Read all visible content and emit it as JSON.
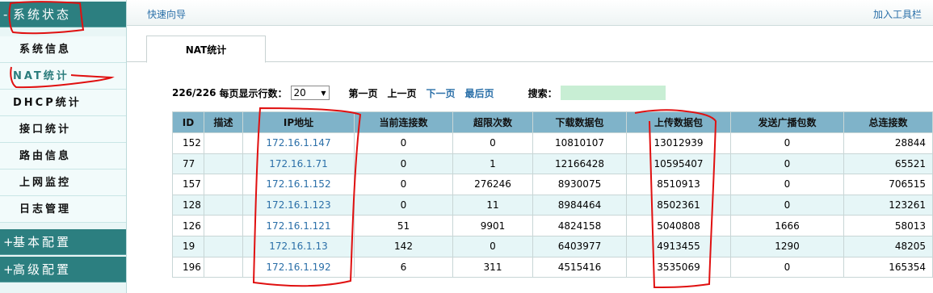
{
  "sidebar": {
    "sections": [
      {
        "sign": "-",
        "label": "系统状态"
      },
      {
        "sign": "+",
        "label": "基本配置"
      },
      {
        "sign": "+",
        "label": "高级配置"
      }
    ],
    "items": [
      "系统信息",
      "NAT统计",
      "DHCP统计",
      "接口统计",
      "路由信息",
      "上网监控",
      "日志管理"
    ]
  },
  "topbar": {
    "quick_guide": "快速向导",
    "add_toolbar": "加入工具栏"
  },
  "tab": {
    "label": "NAT统计"
  },
  "pager": {
    "count": "226/226",
    "rows_label": "每页显示行数：",
    "rows_value": "20",
    "first": "第一页",
    "prev": "上一页",
    "next": "下一页",
    "last": "最后页",
    "search_label": "搜索："
  },
  "table": {
    "headers": [
      "ID",
      "描述",
      "IP地址",
      "当前连接数",
      "超限次数",
      "下载数据包",
      "上传数据包",
      "发送广播包数",
      "总连接数"
    ],
    "rows": [
      [
        "152",
        "",
        "172.16.1.147",
        "0",
        "0",
        "10810107",
        "13012939",
        "0",
        "28844"
      ],
      [
        "77",
        "",
        "172.16.1.71",
        "0",
        "1",
        "12166428",
        "10595407",
        "0",
        "65521"
      ],
      [
        "157",
        "",
        "172.16.1.152",
        "0",
        "276246",
        "8930075",
        "8510913",
        "0",
        "706515"
      ],
      [
        "128",
        "",
        "172.16.1.123",
        "0",
        "11",
        "8984464",
        "8502361",
        "0",
        "123261"
      ],
      [
        "126",
        "",
        "172.16.1.121",
        "51",
        "9901",
        "4824158",
        "5040808",
        "1666",
        "58013"
      ],
      [
        "19",
        "",
        "172.16.1.13",
        "142",
        "0",
        "6403977",
        "4913455",
        "1290",
        "48205"
      ],
      [
        "196",
        "",
        "172.16.1.192",
        "6",
        "311",
        "4515416",
        "3535069",
        "0",
        "165354"
      ]
    ]
  },
  "colors": {
    "sidebar_header": "#2c7f80",
    "table_header": "#7fb3c9",
    "link": "#2a6fa8",
    "annotation": "#e01010"
  }
}
